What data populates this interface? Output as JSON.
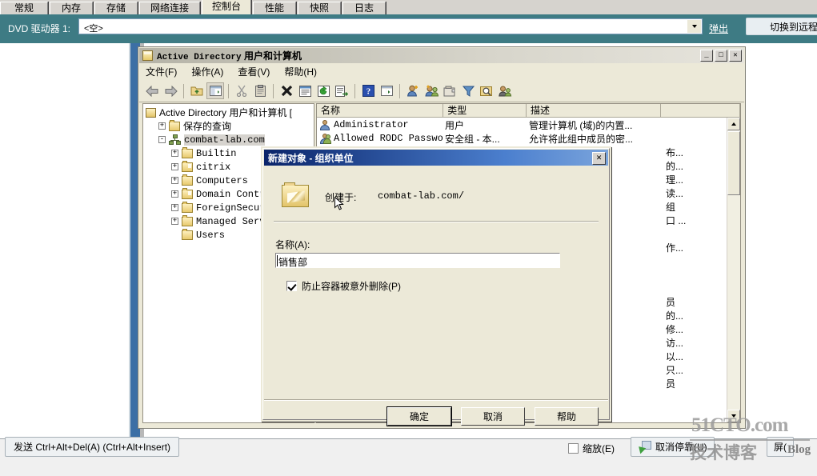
{
  "vm_tabs": [
    {
      "label": "常规",
      "active": false
    },
    {
      "label": "内存",
      "active": false
    },
    {
      "label": "存储",
      "active": false
    },
    {
      "label": "网络连接",
      "active": false
    },
    {
      "label": "控制台",
      "active": true
    },
    {
      "label": "性能",
      "active": false
    },
    {
      "label": "快照",
      "active": false
    },
    {
      "label": "日志",
      "active": false
    }
  ],
  "vmbar": {
    "dvd_label": "DVD 驱动器 1:",
    "dvd_value": "<空>",
    "eject_label": "弹出",
    "switch_label": "切换到远程"
  },
  "mmc": {
    "title_en": "Active Directory",
    "title_cn": "用户和计算机",
    "minimize": "_",
    "maximize": "□",
    "close": "✕",
    "menu": [
      "文件(F)",
      "操作(A)",
      "查看(V)",
      "帮助(H)"
    ],
    "tree": [
      {
        "label": "Active Directory 用户和计算机  [",
        "indent": 0,
        "expander": "",
        "icon": "console-root-icon",
        "selected": false,
        "mono": false
      },
      {
        "label": "保存的查询",
        "indent": 1,
        "expander": "+",
        "icon": "folder-icon",
        "selected": false,
        "mono": false
      },
      {
        "label": "combat-lab.com",
        "indent": 1,
        "expander": "-",
        "icon": "domain-icon",
        "selected": true,
        "mono": true
      },
      {
        "label": "Builtin",
        "indent": 2,
        "expander": "+",
        "icon": "folder-icon",
        "selected": false,
        "mono": true
      },
      {
        "label": "citrix",
        "indent": 2,
        "expander": "+",
        "icon": "ou-folder-icon",
        "selected": false,
        "mono": true
      },
      {
        "label": "Computers",
        "indent": 2,
        "expander": "+",
        "icon": "folder-icon",
        "selected": false,
        "mono": true
      },
      {
        "label": "Domain Controll",
        "indent": 2,
        "expander": "+",
        "icon": "ou-folder-icon",
        "selected": false,
        "mono": true
      },
      {
        "label": "ForeignSecurity",
        "indent": 2,
        "expander": "+",
        "icon": "folder-icon",
        "selected": false,
        "mono": true
      },
      {
        "label": "Managed Service",
        "indent": 2,
        "expander": "+",
        "icon": "folder-icon",
        "selected": false,
        "mono": true
      },
      {
        "label": "Users",
        "indent": 2,
        "expander": "",
        "icon": "folder-icon",
        "selected": false,
        "mono": true
      }
    ],
    "list_columns": [
      "名称",
      "类型",
      "描述",
      ""
    ],
    "list_rows": [
      {
        "icon": "user-icon",
        "name": "Administrator",
        "type": "用户",
        "desc": "管理计算机 (域)的内置..."
      },
      {
        "icon": "group-icon",
        "name": "Allowed RODC Passwo...",
        "type": "安全组 - 本...",
        "desc": "允许将此组中成员的密..."
      }
    ],
    "obscured_desc_fragments": [
      "布...",
      "的...",
      "理...",
      "读...",
      "组",
      "口 ...",
      "",
      "作...",
      "",
      "",
      "",
      "员",
      "的...",
      "修...",
      "访...",
      "以...",
      "只...",
      "员"
    ]
  },
  "dialog": {
    "title": "新建对象 - 组织单位",
    "close": "✕",
    "created_in_label": "创建于:",
    "created_in_value": "combat-lab.com/",
    "name_label": "名称(A):",
    "name_value": "销售部",
    "protect_label": "防止容器被意外删除(P)",
    "protect_checked": true,
    "buttons": [
      {
        "label": "确定",
        "default": true
      },
      {
        "label": "取消",
        "default": false
      },
      {
        "label": "帮助",
        "default": false
      }
    ]
  },
  "bottom": {
    "send_cad": "发送 Ctrl+Alt+Del(A) (Ctrl+Alt+Insert)",
    "zoom_label": "缩放(E)",
    "zoom_checked": false,
    "undock_label": "取消停靠(U)",
    "fullscreen_label": "屏("
  },
  "watermark": {
    "line1": "51CTO.com",
    "line2": "技术博客",
    "line3": "Blog"
  },
  "colors": {
    "vmbar_teal": "#3e7b84",
    "dialog_title_blue": "#0a246a",
    "selection_gray": "#d6d3ce",
    "window_face": "#ece9d8",
    "blue_band": "#3c6fa5"
  }
}
